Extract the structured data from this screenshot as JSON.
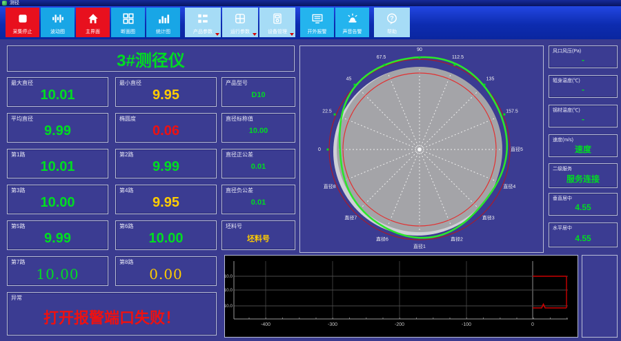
{
  "window": {
    "title": "测径"
  },
  "colors": {
    "bg": "#3a3b8f",
    "panel": "#3b3c92",
    "border": "#b9bdd6",
    "green": "#00dd22",
    "yellow": "#ffcc00",
    "red": "#ee1111",
    "button_red": "#e8101e",
    "button_cyan": "#18a6e6",
    "button_cyan2": "#24b4ee",
    "button_light": "#a6dcf6",
    "chart_red": "#cc0000",
    "profile_green": "#2ce62c",
    "tolerance_red_outer": "#a81b2c",
    "tolerance_red_inner": "#e23030",
    "section_gray": "#a4a4a8"
  },
  "toolbar": {
    "buttons": [
      {
        "id": "stop-capture",
        "label": "采集停止",
        "icon": "stop",
        "style": "red"
      },
      {
        "id": "wave-chart",
        "label": "波动图",
        "icon": "waveform",
        "style": "cyan"
      },
      {
        "id": "main-view",
        "label": "主界面",
        "icon": "home",
        "style": "red"
      },
      {
        "id": "section-view",
        "label": "断面图",
        "icon": "sections",
        "style": "cyan"
      },
      {
        "id": "stats-chart",
        "label": "统计图",
        "icon": "bars",
        "style": "cyan"
      },
      {
        "id": "product-params",
        "label": "产品参数",
        "icon": "list",
        "style": "light",
        "group_start": true,
        "dropdown": true
      },
      {
        "id": "run-params",
        "label": "运行参数",
        "icon": "grid",
        "style": "light",
        "dropdown": true
      },
      {
        "id": "device-mgmt",
        "label": "设备管理",
        "icon": "device",
        "style": "light",
        "dropdown": true
      },
      {
        "id": "external-alarm",
        "label": "开外报警",
        "icon": "monitor",
        "style": "cyan2",
        "group_start": true
      },
      {
        "id": "sound-alarm",
        "label": "声音告警",
        "icon": "alarm",
        "style": "cyan2"
      },
      {
        "id": "help",
        "label": "帮助",
        "icon": "help",
        "style": "light",
        "group_start": true
      }
    ]
  },
  "left": {
    "title": "3#测径仪",
    "cells": [
      {
        "id": "max-diameter",
        "label": "最大直径",
        "value": "10.01",
        "color": "green",
        "row": 0,
        "col": 0,
        "size": "big"
      },
      {
        "id": "min-diameter",
        "label": "最小直径",
        "value": "9.95",
        "color": "yellow",
        "row": 0,
        "col": 1,
        "size": "big"
      },
      {
        "id": "product-model",
        "label": "产品型号",
        "value": "D10",
        "color": "green",
        "row": 0,
        "col": 2,
        "size": "small"
      },
      {
        "id": "avg-diameter",
        "label": "平均直径",
        "value": "9.99",
        "color": "green",
        "row": 1,
        "col": 0,
        "size": "big"
      },
      {
        "id": "ovality",
        "label": "椭圆度",
        "value": "0.06",
        "color": "red",
        "row": 1,
        "col": 1,
        "size": "big"
      },
      {
        "id": "nominal-diameter",
        "label": "直径标称值",
        "value": "10.00",
        "color": "green",
        "row": 1,
        "col": 2,
        "size": "small"
      },
      {
        "id": "channel-1",
        "label": "第1路",
        "value": "10.01",
        "color": "green",
        "row": 2,
        "col": 0,
        "size": "big"
      },
      {
        "id": "channel-2",
        "label": "第2路",
        "value": "9.99",
        "color": "green",
        "row": 2,
        "col": 1,
        "size": "big"
      },
      {
        "id": "plus-tolerance",
        "label": "直径正公差",
        "value": "0.01",
        "color": "green",
        "row": 2,
        "col": 2,
        "size": "small"
      },
      {
        "id": "channel-3",
        "label": "第3路",
        "value": "10.00",
        "color": "green",
        "row": 3,
        "col": 0,
        "size": "big"
      },
      {
        "id": "channel-4",
        "label": "第4路",
        "value": "9.95",
        "color": "yellow",
        "row": 3,
        "col": 1,
        "size": "big"
      },
      {
        "id": "minus-tolerance",
        "label": "直径负公差",
        "value": "0.01",
        "color": "green",
        "row": 3,
        "col": 2,
        "size": "small"
      },
      {
        "id": "channel-5",
        "label": "第5路",
        "value": "9.99",
        "color": "green",
        "row": 4,
        "col": 0,
        "size": "big"
      },
      {
        "id": "channel-6",
        "label": "第6路",
        "value": "10.00",
        "color": "green",
        "row": 4,
        "col": 1,
        "size": "big"
      },
      {
        "id": "billet-no",
        "label": "坯料号",
        "value": "坯料号",
        "color": "yellow",
        "row": 4,
        "col": 2,
        "size": "small"
      },
      {
        "id": "channel-7",
        "label": "第7路",
        "value": "10.00",
        "color": "green",
        "row": 5,
        "col": 0,
        "size": "big",
        "serif": true
      },
      {
        "id": "channel-8",
        "label": "第8路",
        "value": "0.00",
        "color": "yellow",
        "row": 5,
        "col": 1,
        "size": "big",
        "serif": true
      },
      {
        "id": "exception",
        "label": "异常",
        "value": "打开报警端口失败！",
        "color": "red",
        "row": 6,
        "col": 0,
        "span": 2,
        "tall": true,
        "size": "big",
        "alarm": true
      }
    ]
  },
  "right": {
    "panels": [
      {
        "id": "air-pressure",
        "label": "风口风压(Pa)",
        "value": "-"
      },
      {
        "id": "roll-temp",
        "label": "辊身温度(℃)",
        "value": "-"
      },
      {
        "id": "steel-temp",
        "label": "钢材温度(℃)",
        "value": "-"
      },
      {
        "id": "speed",
        "label": "速度(m/s)",
        "value": "速度"
      },
      {
        "id": "l2-service",
        "label": "二级服务",
        "value": "服务连接"
      },
      {
        "id": "vertical-center",
        "label": "垂直居中",
        "value": "4.55"
      },
      {
        "id": "horizontal-center",
        "label": "水平居中",
        "value": "4.55"
      }
    ]
  },
  "polar": {
    "angle_labels": [
      {
        "text": "0",
        "deg": 180
      },
      {
        "text": "22.5",
        "deg": 157.5
      },
      {
        "text": "45",
        "deg": 135
      },
      {
        "text": "67.5",
        "deg": 112.5
      },
      {
        "text": "90",
        "deg": 90
      },
      {
        "text": "112.5",
        "deg": 67.5
      },
      {
        "text": "135",
        "deg": 45
      },
      {
        "text": "157.5",
        "deg": 22.5
      }
    ],
    "diameter_labels": [
      {
        "text": "直径5",
        "deg": 0
      },
      {
        "text": "直径4",
        "deg": 337.5
      },
      {
        "text": "直径3",
        "deg": 315
      },
      {
        "text": "直径2",
        "deg": 292.5
      },
      {
        "text": "直径1",
        "deg": 270
      },
      {
        "text": "直径6",
        "deg": 247.5
      },
      {
        "text": "直径7",
        "deg": 225
      },
      {
        "text": "直径8",
        "deg": 202.5
      }
    ],
    "spokes": 16,
    "gray_radius": 120,
    "outer_tolerance_radius": 131,
    "inner_tolerance_radius": 111,
    "profile": {
      "base": 126,
      "h1s": 5,
      "h1c": 3,
      "h2c": -5,
      "h3a": 2,
      "h3p": 0.7,
      "h5a": 1.5,
      "h5p": 2
    }
  },
  "trend": {
    "x_ticks": [
      "-400",
      "-300",
      "-200",
      "-100",
      "0"
    ],
    "y_ticks": [
      "10.0",
      "10.0",
      "10.0"
    ]
  }
}
